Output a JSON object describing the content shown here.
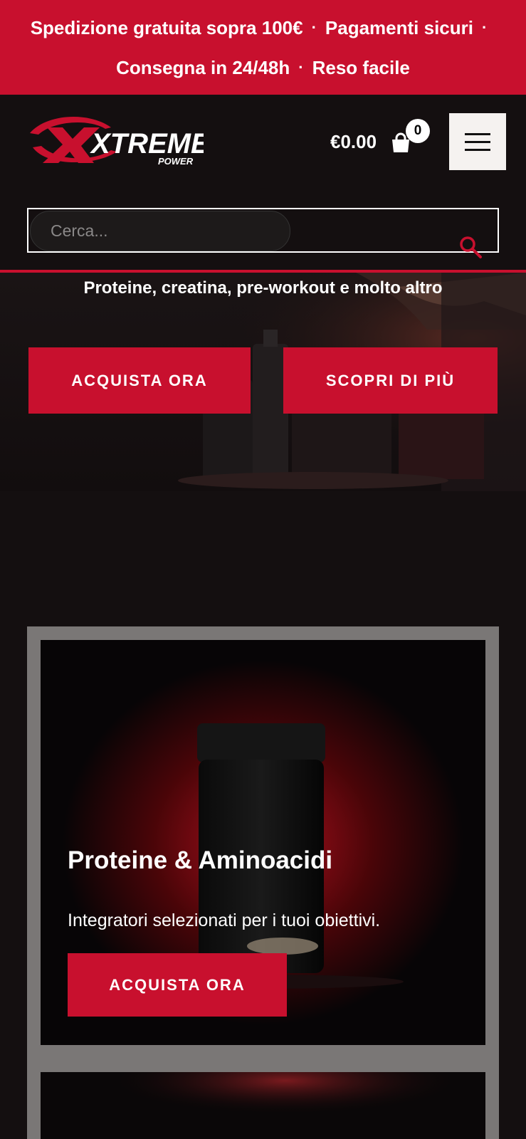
{
  "topbar": {
    "line1": [
      "Spedizione gratuita sopra 100€",
      "Pagamenti sicuri"
    ],
    "line2": [
      "Consegna in 24/48h",
      "Reso facile"
    ],
    "separator": "·"
  },
  "header": {
    "logo_text": "XTREME",
    "logo_sub": "POWER",
    "cart_total": "€0.00",
    "cart_count": "0",
    "cart_icon": "shopping-bag-icon",
    "menu_icon": "hamburger-menu-icon"
  },
  "search": {
    "placeholder": "Cerca...",
    "icon": "search-icon"
  },
  "hero": {
    "subtitle": "Proteine, creatina, pre-workout e molto altro",
    "primary_button": "ACQUISTA ORA",
    "secondary_button": "SCOPRI DI PIÙ"
  },
  "categories": [
    {
      "title": "Proteine & Aminoacidi",
      "description": "Integratori selezionati per i tuoi obiettivi.",
      "button": "ACQUISTA ORA"
    }
  ],
  "colors": {
    "accent": "#c8102e",
    "background": "#140f10",
    "frame": "#7a7776"
  }
}
